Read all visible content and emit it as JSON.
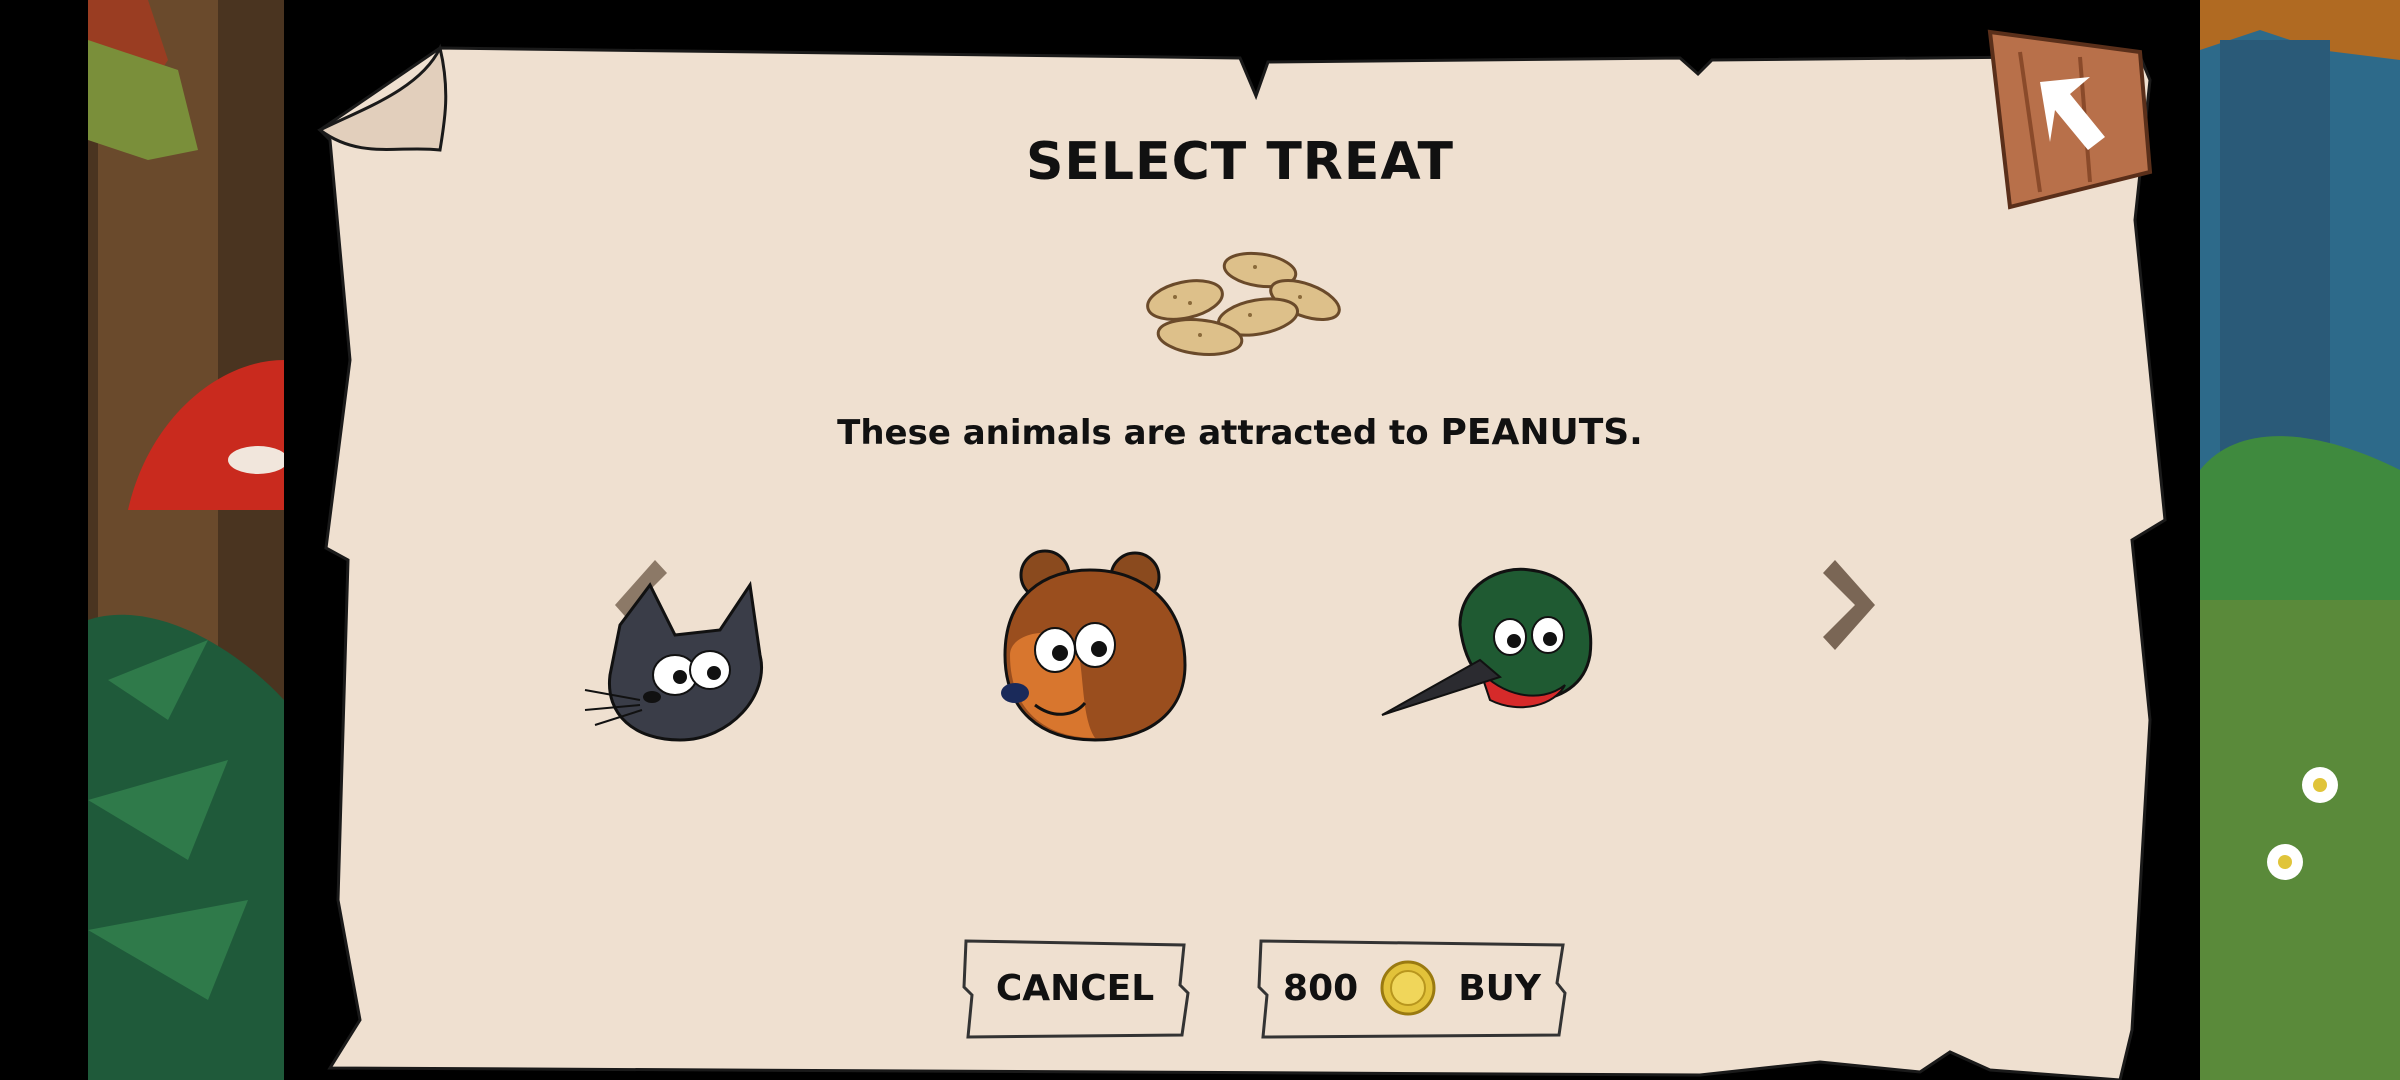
{
  "dialog": {
    "title": "SELECT TREAT",
    "description_prefix": "These animals are attracted to ",
    "treat_name": "PEANUTS.",
    "treat_icon": "peanuts-icon"
  },
  "animals": [
    {
      "name": "cat",
      "icon": "cat-head-icon"
    },
    {
      "name": "bear",
      "icon": "bear-head-icon"
    },
    {
      "name": "hummingbird",
      "icon": "hummingbird-head-icon"
    }
  ],
  "navigation": {
    "prev_icon": "chevron-left-icon",
    "next_icon": "chevron-right-icon",
    "back_icon": "back-arrow-icon"
  },
  "buttons": {
    "cancel_label": "CANCEL",
    "buy_price": "800",
    "buy_label": "BUY",
    "currency_icon": "gold-coin-icon"
  },
  "colors": {
    "parchment": "#efe0d0",
    "wood": "#b8704a",
    "text": "#111111",
    "coin": "#e2c23a"
  }
}
